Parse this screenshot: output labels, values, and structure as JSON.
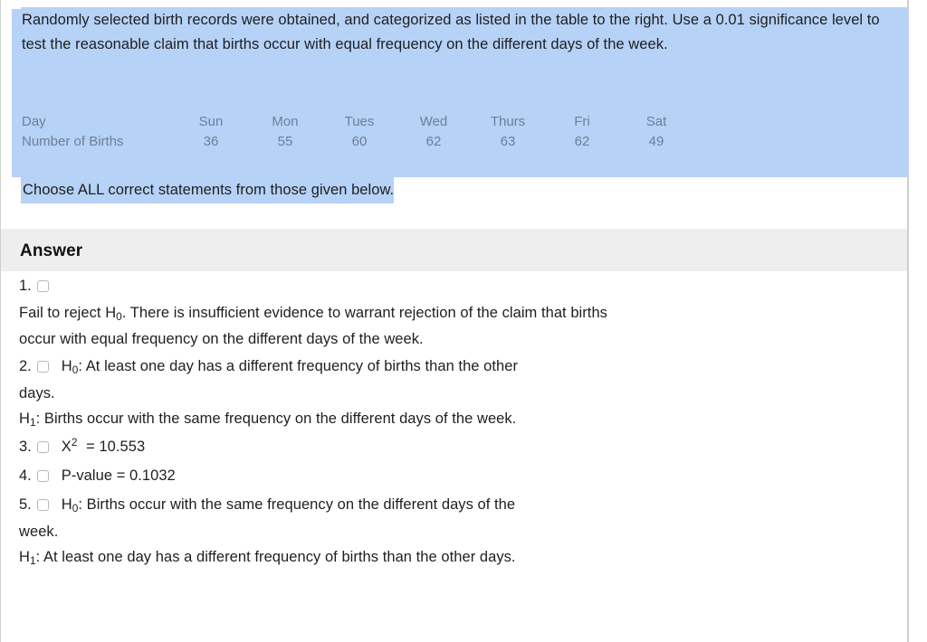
{
  "question": {
    "prompt": "Randomly selected birth records were obtained, and categorized as listed in the table to the right. Use a 0.01 significance level to test the reasonable claim that births occur with equal frequency on the different days of the week.",
    "instruction": "Choose ALL correct statements from those given below."
  },
  "table": {
    "row_labels": [
      "Day",
      "Number of Births"
    ],
    "days": [
      "Sun",
      "Mon",
      "Tues",
      "Wed",
      "Thurs",
      "Fri",
      "Sat"
    ],
    "births": [
      "36",
      "55",
      "60",
      "62",
      "63",
      "62",
      "49"
    ]
  },
  "answer": {
    "header": "Answer",
    "options": [
      {
        "number": "1.",
        "inline": "",
        "body": "Fail to reject H₀. There is insufficient evidence to warrant rejection of the claim that births occur with equal frequency on the different days of the week.",
        "body_lead": "Fail to reject H",
        "body_sub": "0",
        "body_rest": ". There is insufficient evidence to warrant rejection of the claim that births occur with equal frequency on the different days of the week.",
        "cont_lead": "",
        "cont_sub": "",
        "cont_rest": ""
      },
      {
        "number": "2.",
        "inline_lead": "H",
        "inline_sub": "0",
        "inline_rest": ": At least one day has a different frequency of births than the other",
        "body_lead": "days.",
        "cont_lead": "H",
        "cont_sub": "1",
        "cont_rest": ": Births occur with the same frequency on the different days of the week."
      },
      {
        "number": "3.",
        "inline_lead": "X",
        "inline_sup": "2",
        "inline_rest": " = 10.553"
      },
      {
        "number": "4.",
        "inline_lead": "P-value = 0.1032",
        "inline_rest": ""
      },
      {
        "number": "5.",
        "inline_lead": "H",
        "inline_sub": "0",
        "inline_rest": ": Births occur with the same frequency on the different days of the",
        "body_lead": "week.",
        "cont_lead": "H",
        "cont_sub": "1",
        "cont_rest": ": At least one day has a different frequency of births than the other days."
      }
    ]
  },
  "colors": {
    "selection_blue": "#b6d2f7",
    "answer_band_gray": "#eeeeee",
    "table_text": "#6d7f95",
    "body_text": "#1f1f1f",
    "rule": "#cfcfcf"
  }
}
